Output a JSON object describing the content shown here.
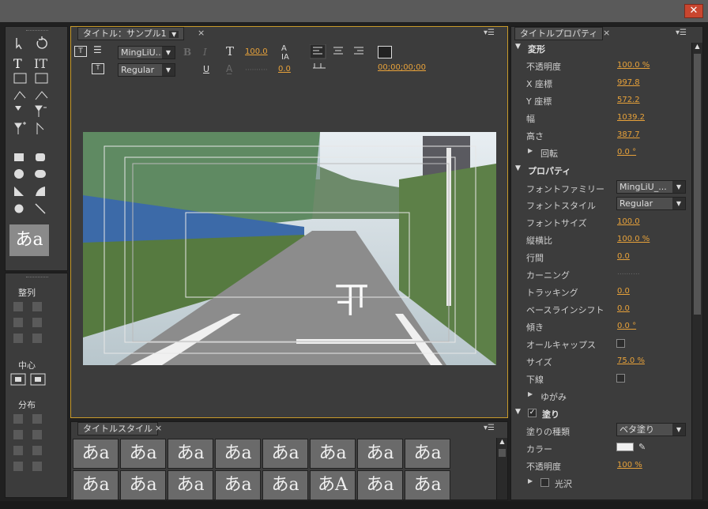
{
  "window": {
    "close_glyph": "✕"
  },
  "tools_panel": {
    "tools": [
      "selection-tool",
      "rotation-tool",
      "type-tool",
      "vertical-type-tool",
      "area-type-tool",
      "vertical-area-type-tool",
      "path-type-tool",
      "vertical-path-type-tool",
      "pen-tool",
      "delete-anchor-tool",
      "add-anchor-tool",
      "convert-anchor-tool",
      "rectangle-tool",
      "rounded-rectangle-tool",
      "ellipse-rounded-tool",
      "rounded-corner-tool",
      "wedge-tool",
      "arc-tool",
      "ellipse-tool",
      "line-tool"
    ],
    "preview_glyph": "あa"
  },
  "actions_panel": {
    "align_label": "整列",
    "center_label": "中心",
    "distribute_label": "分布"
  },
  "title_panel": {
    "tab_label": "タイトル：サンプル1",
    "font_family": "MingLiU...",
    "font_style": "Regular",
    "font_size": "100.0",
    "kerning": "0.0",
    "timecode": "00;00;00;00",
    "bold": "B",
    "italic": "I",
    "underline": "U"
  },
  "styles_panel": {
    "tab_label": "タイトルスタイル",
    "row1": [
      "あa",
      "あa",
      "あa",
      "あa",
      "あa",
      "あa",
      "あa",
      "あa"
    ],
    "row2": [
      "あa",
      "あa",
      "あa",
      "あa",
      "あa",
      "あA",
      "あa",
      "あa"
    ]
  },
  "properties": {
    "tab_label": "タイトルプロパティ",
    "transform_label": "変形",
    "opacity_label": "不透明度",
    "opacity": "100.0 %",
    "x_label": "X 座標",
    "x": "997.8",
    "y_label": "Y 座標",
    "y": "572.2",
    "width_label": "幅",
    "width": "1039.2",
    "height_label": "高さ",
    "height": "387.7",
    "rotation_label": "回転",
    "rotation": "0.0 °",
    "props_label": "プロパティ",
    "font_family_label": "フォントファミリー",
    "font_family": "MingLiU_...",
    "font_style_label": "フォントスタイル",
    "font_style": "Regular",
    "font_size_label": "フォントサイズ",
    "font_size": "100.0",
    "aspect_label": "縦横比",
    "aspect": "100.0 %",
    "leading_label": "行間",
    "leading": "0.0",
    "kerning_label": "カーニング",
    "kerning": "..........",
    "tracking_label": "トラッキング",
    "tracking": "0.0",
    "baseline_label": "ベースラインシフト",
    "baseline": "0.0",
    "slant_label": "傾き",
    "slant": "0.0 °",
    "allcaps_label": "オールキャップス",
    "smallcaps_size_label": "サイズ",
    "smallcaps_size": "75.0 %",
    "underline_label": "下線",
    "distort_label": "ゆがみ",
    "fill_label": "塗り",
    "fill_type_label": "塗りの種類",
    "fill_type": "ベタ塗り",
    "color_label": "カラー",
    "fill_opacity_label": "不透明度",
    "fill_opacity": "100 %",
    "sheen_label": "光沢"
  },
  "colors": {
    "accent": "#e8a23a",
    "panel": "#3c3c3c",
    "dark": "#202020"
  }
}
